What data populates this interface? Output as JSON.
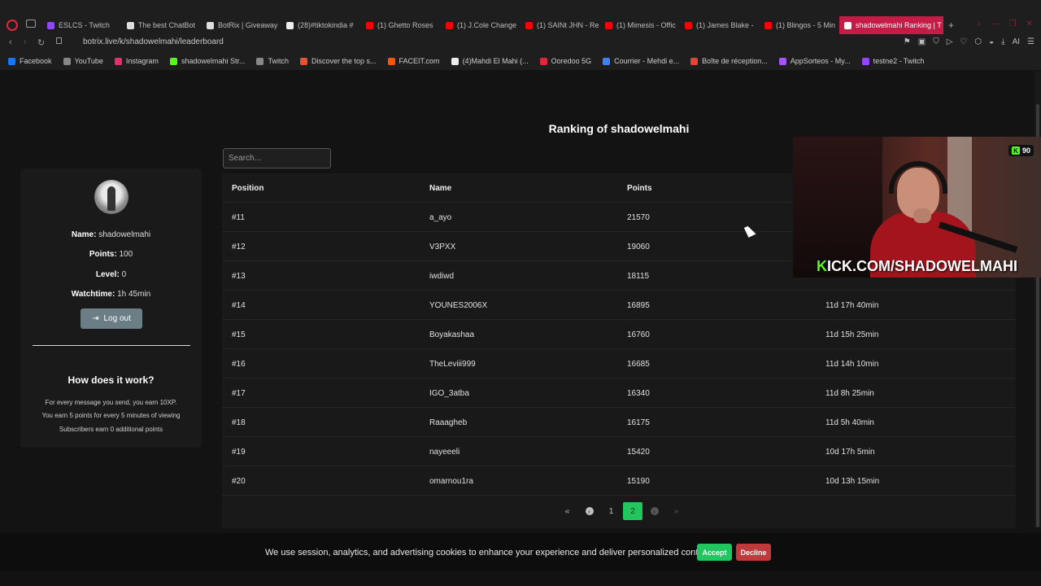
{
  "browser": {
    "tabs": [
      {
        "label": "ESLCS - Twitch",
        "color": "#9146ff"
      },
      {
        "label": "The best ChatBot",
        "color": "#dddddd"
      },
      {
        "label": "BotRix | Giveaway",
        "color": "#dddddd"
      },
      {
        "label": "(28)#tiktokindia #",
        "color": "#eeeeee"
      },
      {
        "label": "(1) Ghetto Roses",
        "color": "#ff0000"
      },
      {
        "label": "(1) J.Cole Change",
        "color": "#ff0000"
      },
      {
        "label": "(1) SAINt JHN - Re",
        "color": "#ff0000"
      },
      {
        "label": "(1) Mimesis - Offic",
        "color": "#ff0000"
      },
      {
        "label": "(1) James Blake -",
        "color": "#ff0000"
      },
      {
        "label": "(1) Blingos - 5 Min",
        "color": "#ff0000"
      }
    ],
    "active_tab": {
      "label": "shadowelmahi Ranking | T",
      "close": "×"
    },
    "new_tab": "+",
    "url": "botrix.live/k/shadowelmahi/leaderboard",
    "toolbar_ai": "AI",
    "bookmarks": [
      {
        "label": "Facebook",
        "color": "#1877f2"
      },
      {
        "label": "YouTube",
        "color": "#888888"
      },
      {
        "label": "Instagram",
        "color": "#e1306c"
      },
      {
        "label": "shadowelmahi Str...",
        "color": "#53fc18"
      },
      {
        "label": "Twitch",
        "color": "#888888"
      },
      {
        "label": "Discover the top s...",
        "color": "#e8522e"
      },
      {
        "label": "FACEIT.com",
        "color": "#ff5500"
      },
      {
        "label": "(4)Mahdi El Mahi (...",
        "color": "#eeeeee"
      },
      {
        "label": "Ooredoo 5G",
        "color": "#e0283a"
      },
      {
        "label": "Courrier - Mehdi e...",
        "color": "#3b82f6"
      },
      {
        "label": "Boîte de réception...",
        "color": "#ea4335"
      },
      {
        "label": "AppSorteos - My...",
        "color": "#a855f7"
      },
      {
        "label": "testne2 - Twitch",
        "color": "#9146ff"
      }
    ]
  },
  "page": {
    "title": "Ranking of shadowelmahi",
    "search_placeholder": "Search..."
  },
  "profile": {
    "name_label": "Name:",
    "name_value": "shadowelmahi",
    "points_label": "Points:",
    "points_value": "100",
    "level_label": "Level:",
    "level_value": "0",
    "watchtime_label": "Watchtime:",
    "watchtime_value": "1h 45min",
    "logout_label": "Log out",
    "how_title": "How does it work?",
    "how_lines": [
      "For every message you send, you earn 10XP.",
      "You earn 5 points for every 5 minutes of viewing",
      "Subscribers earn 0 additional points"
    ]
  },
  "table": {
    "headers": [
      "Position",
      "Name",
      "Points"
    ],
    "rows": [
      {
        "position": "#11",
        "name": "a_ayo",
        "points": "21570",
        "watchtime": ""
      },
      {
        "position": "#12",
        "name": "V3PXX",
        "points": "19060",
        "watchtime": ""
      },
      {
        "position": "#13",
        "name": "iwdiwd",
        "points": "18115",
        "watchtime": ""
      },
      {
        "position": "#14",
        "name": "YOUNES2006X",
        "points": "16895",
        "watchtime": "11d 17h 40min"
      },
      {
        "position": "#15",
        "name": "Boyakashaa",
        "points": "16760",
        "watchtime": "11d 15h 25min"
      },
      {
        "position": "#16",
        "name": "TheLeviii999",
        "points": "16685",
        "watchtime": "11d 14h 10min"
      },
      {
        "position": "#17",
        "name": "IGO_3atba",
        "points": "16340",
        "watchtime": "11d 8h 25min"
      },
      {
        "position": "#18",
        "name": "Raaagheb",
        "points": "16175",
        "watchtime": "11d 5h 40min"
      },
      {
        "position": "#19",
        "name": "nayeeeli",
        "points": "15420",
        "watchtime": "10d 17h 5min"
      },
      {
        "position": "#20",
        "name": "omarnou1ra",
        "points": "15190",
        "watchtime": "10d 13h 15min"
      }
    ]
  },
  "pagination": {
    "first": "«",
    "prev": "‹",
    "pages": [
      "1",
      "2"
    ],
    "current": "2",
    "next": "›",
    "last": "»"
  },
  "overlay": {
    "banner_k": "K",
    "banner_rest": "ICK.COM/SHADOWELMAHI",
    "viewer_count": "90"
  },
  "cookie": {
    "text": "We use session, analytics, and advertising cookies to enhance your experience and deliver personalized content.",
    "accept": "Accept",
    "decline": "Decline"
  }
}
